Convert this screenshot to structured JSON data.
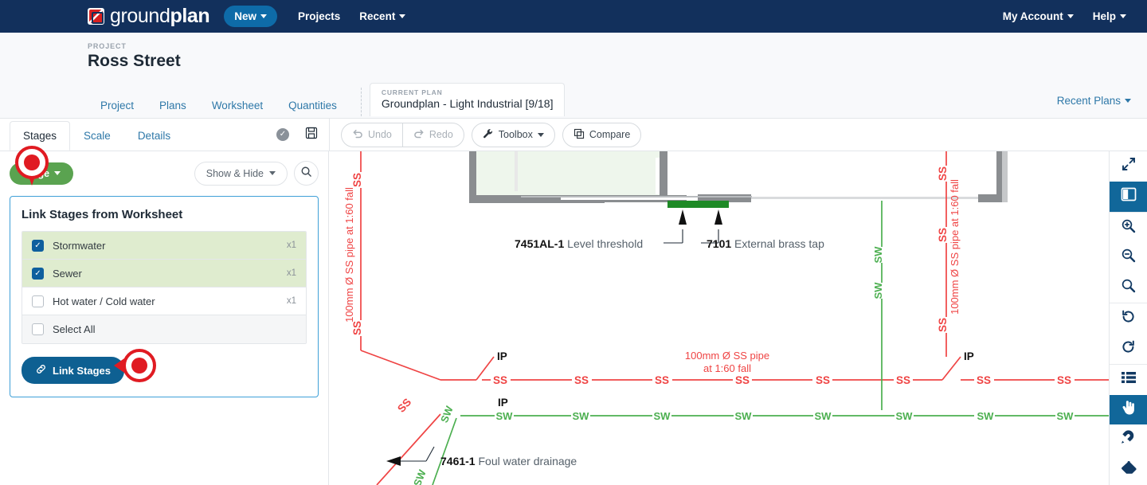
{
  "topnav": {
    "brand_light": "ground",
    "brand_bold": "plan",
    "logo_icon": "groundplan-arrow-logo-icon",
    "new_label": "New",
    "projects_label": "Projects",
    "recent_label": "Recent",
    "my_account_label": "My Account",
    "help_label": "Help",
    "bg_color": "#12305c",
    "new_btn_color": "#0e6ba8"
  },
  "project_header": {
    "kicker": "PROJECT",
    "title": "Ross Street",
    "tabs": [
      {
        "label": "Project"
      },
      {
        "label": "Plans"
      },
      {
        "label": "Worksheet"
      },
      {
        "label": "Quantities"
      }
    ],
    "current_plan": {
      "kicker": "CURRENT PLAN",
      "title": "Groundplan - Light Industrial [9/18]"
    },
    "recent_plans_label": "Recent Plans"
  },
  "work_toolbar": {
    "tabs": [
      {
        "label": "Stages",
        "active": true
      },
      {
        "label": "Scale",
        "active": false
      },
      {
        "label": "Details",
        "active": false
      }
    ],
    "status_icon": "check-circle-icon",
    "save_icon": "save-disk-icon",
    "buttons": [
      {
        "label": "Undo",
        "icon": "undo-arrow-icon",
        "disabled": true
      },
      {
        "label": "Redo",
        "icon": "redo-arrow-icon",
        "disabled": true
      },
      {
        "label": "Toolbox",
        "icon": "wrench-icon",
        "disabled": false,
        "caret": true
      },
      {
        "label": "Compare",
        "icon": "copy-layers-icon",
        "disabled": false
      }
    ]
  },
  "left_panel": {
    "stage_button_label": "Stage",
    "stage_button_color": "#5aa350",
    "show_hide_label": "Show & Hide",
    "search_icon": "search-icon",
    "card": {
      "title": "Link Stages from Worksheet",
      "border_color": "#3fa0d8",
      "items": [
        {
          "label": "Stormwater",
          "qty": "x1",
          "checked": true
        },
        {
          "label": "Sewer",
          "qty": "x1",
          "checked": true
        },
        {
          "label": "Hot water / Cold water",
          "qty": "x1",
          "checked": false
        }
      ],
      "select_all_label": "Select All",
      "select_all_checked": false,
      "link_button_label": "Link Stages",
      "link_button_icon": "chain-link-icon",
      "link_button_color": "#0e6092"
    },
    "markers": [
      {
        "name": "annotation-marker-stage-button",
        "color": "#e01b22"
      },
      {
        "name": "annotation-marker-link-stages",
        "color": "#e01b22"
      }
    ]
  },
  "canvas": {
    "colors": {
      "sewer": "#ef4444",
      "stormwater": "#4caf50",
      "wall": "#8a8d90",
      "door": "#1e8a26"
    },
    "pipe_note_sewer": "100mm Ø SS pipe at 1:60 fall",
    "pipe_note_sewer_right": "100mm Ø SS pipe at 1:60 fall",
    "pipe_note_horizontal_line1": "100mm Ø SS pipe",
    "pipe_note_horizontal_line2": "at 1:60 fall",
    "label_ss": "SS",
    "label_sw": "SW",
    "label_ip": "IP",
    "callouts": [
      {
        "code": "7451AL-1",
        "text": "Level threshold"
      },
      {
        "code": "7101",
        "text": "External brass tap"
      },
      {
        "code": "7461-1",
        "text": "Foul water drainage"
      }
    ]
  },
  "rail": {
    "buttons": [
      {
        "icon": "expand-fullscreen-icon",
        "active": false
      },
      {
        "icon": "split-pane-icon",
        "active": true
      },
      {
        "icon": "zoom-in-icon",
        "active": false
      },
      {
        "icon": "zoom-out-icon",
        "active": false
      },
      {
        "icon": "magnify-icon",
        "active": false
      },
      {
        "icon": "undo-circular-icon",
        "active": false
      },
      {
        "icon": "redo-circular-icon",
        "active": false
      },
      {
        "icon": "list-icon",
        "active": false
      },
      {
        "icon": "hand-pointer-icon",
        "active": true
      },
      {
        "icon": "magnet-icon",
        "active": false
      },
      {
        "icon": "eraser-icon",
        "active": false
      }
    ]
  }
}
